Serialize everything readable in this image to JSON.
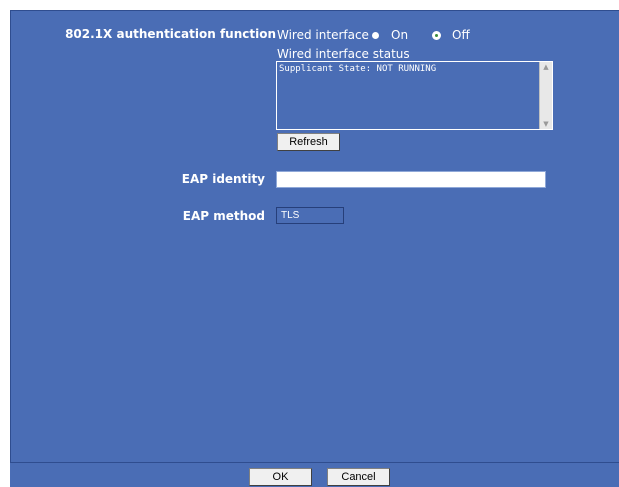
{
  "form": {
    "auth_label": "802.1X authentication function",
    "wired_interface_label": "Wired interface",
    "option_on": "On",
    "option_off": "Off",
    "selected_option": "Off",
    "status_label": "Wired interface status",
    "status_text": "Supplicant State: NOT RUNNING",
    "refresh_label": "Refresh",
    "eap_identity_label": "EAP identity",
    "eap_identity_value": "",
    "eap_method_label": "EAP method",
    "eap_method_value": "TLS"
  },
  "footer": {
    "ok_label": "OK",
    "cancel_label": "Cancel"
  },
  "colors": {
    "panel_background": "#4a6db5",
    "text": "#ffffff"
  }
}
